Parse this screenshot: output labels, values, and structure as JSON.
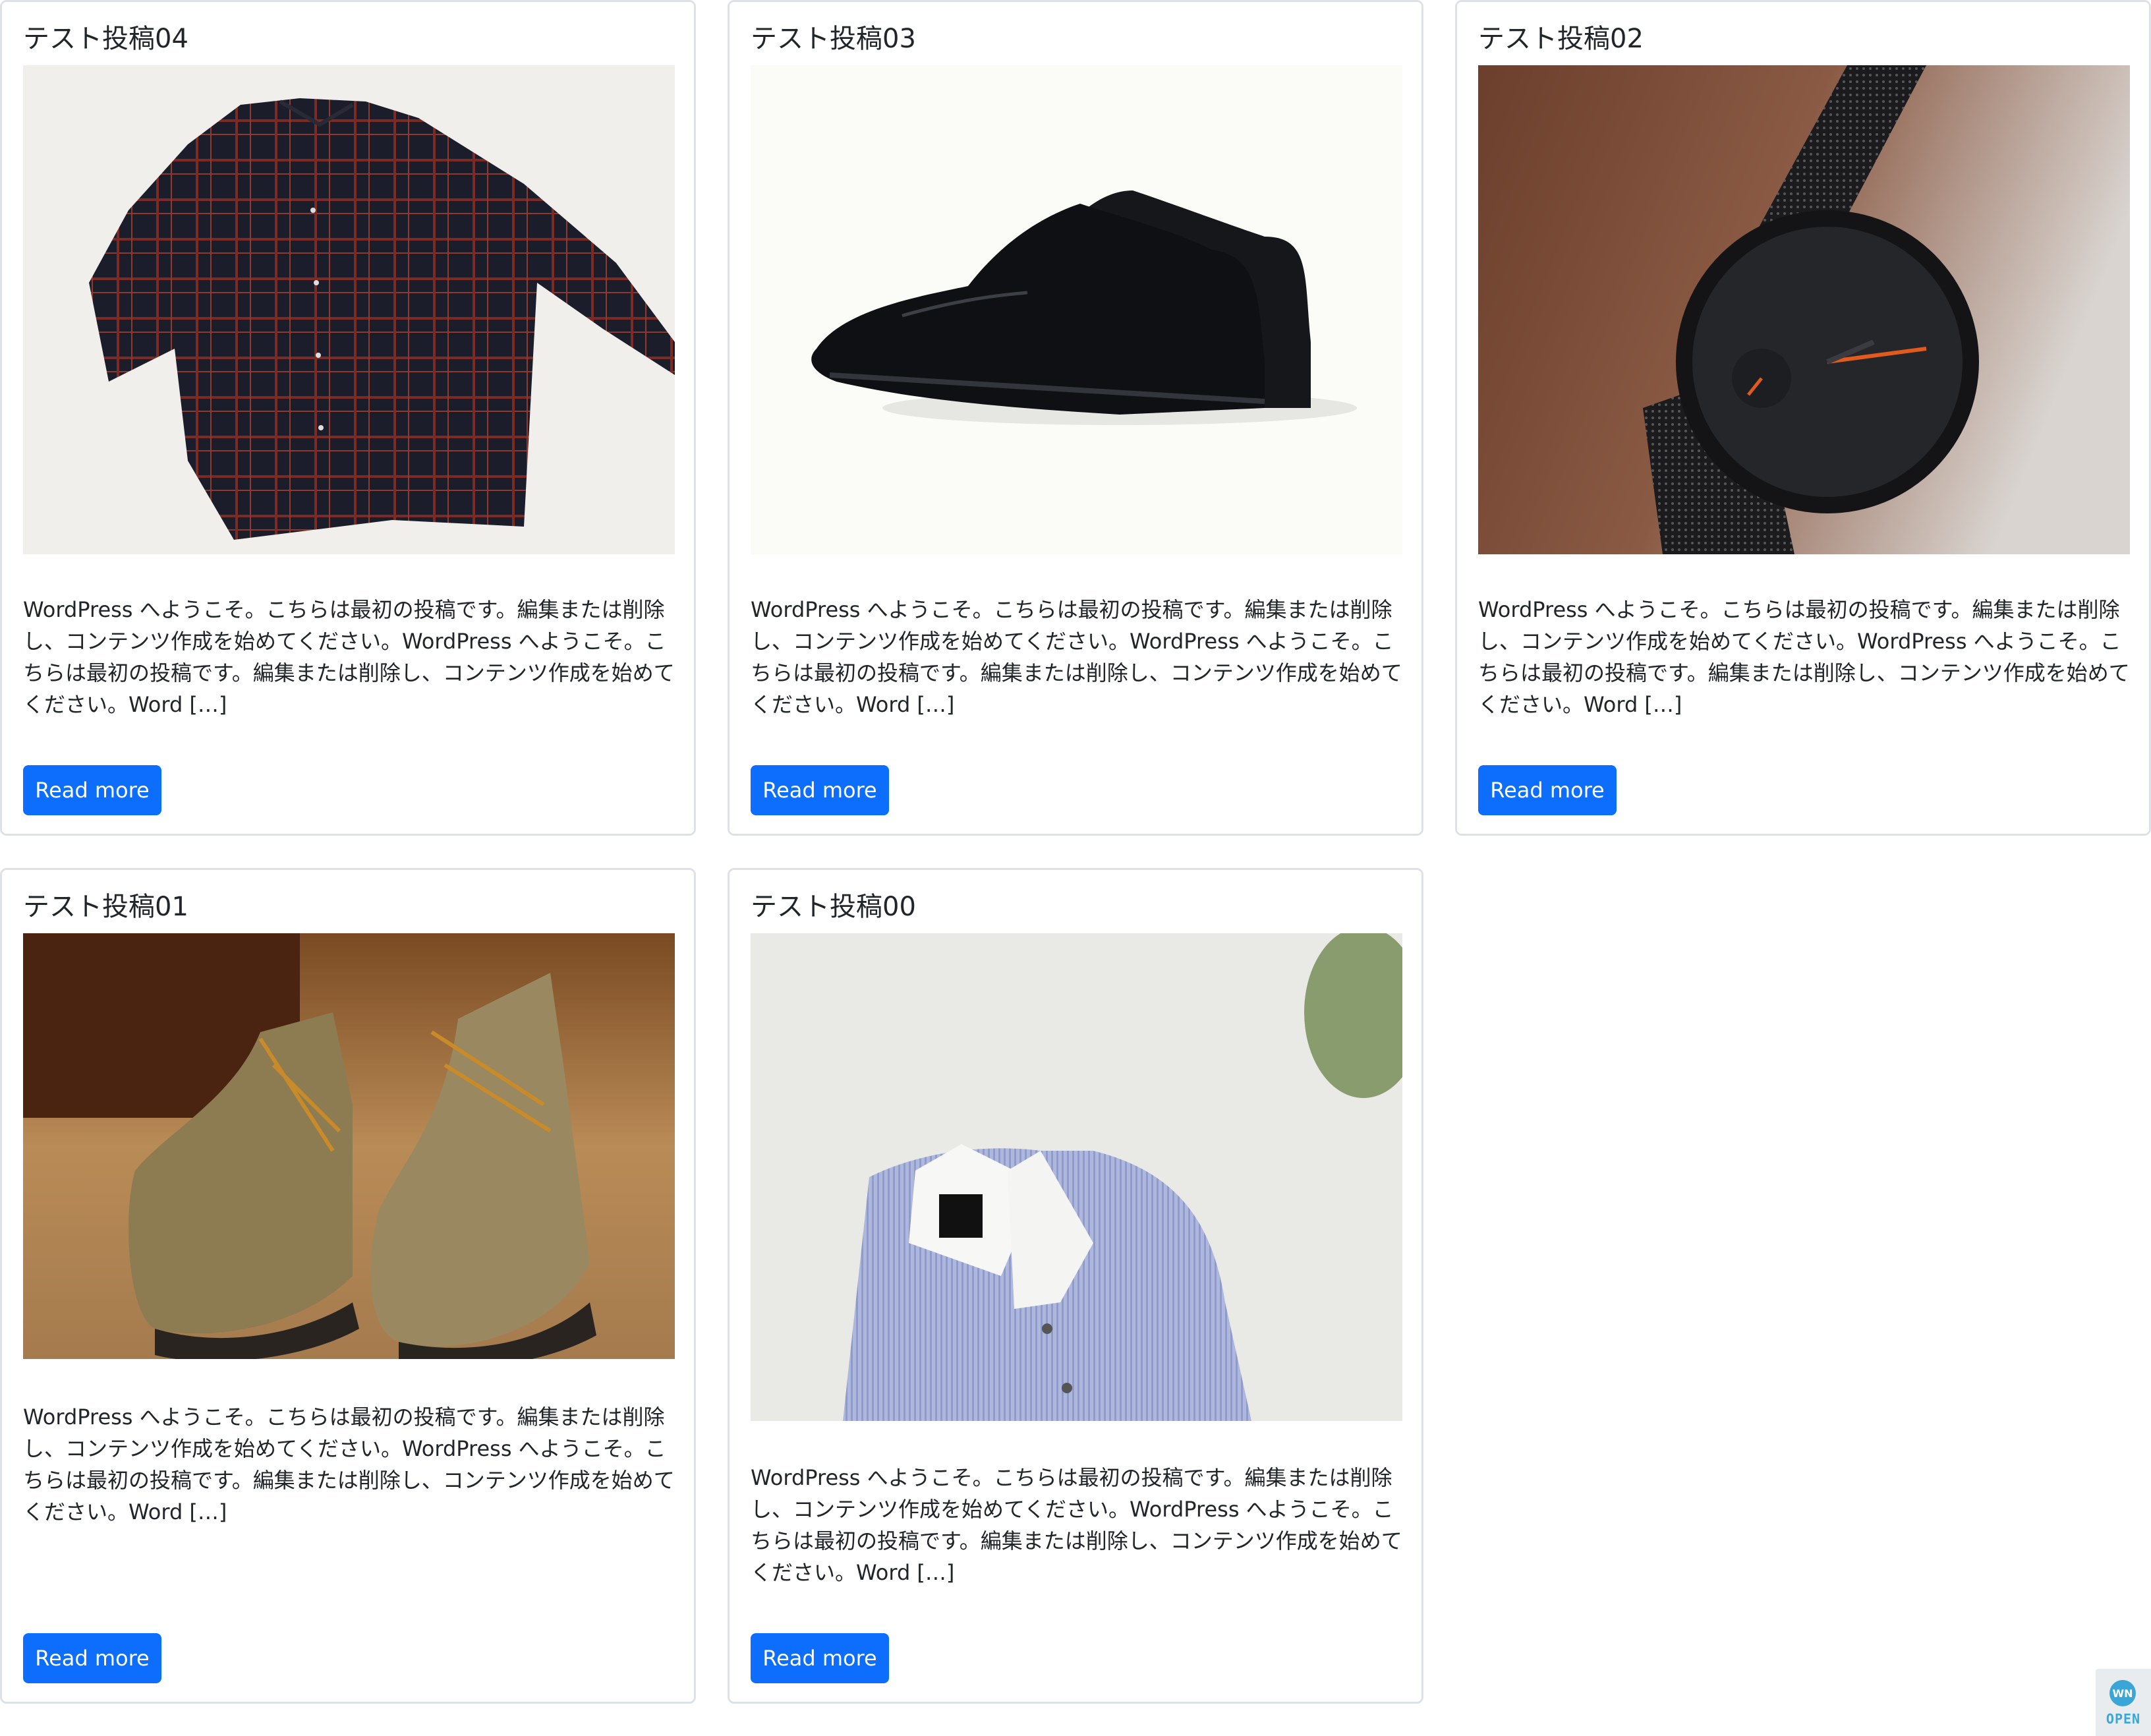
{
  "colors": {
    "button_bg": "#0d6efd",
    "button_text": "#ffffff",
    "card_border": "#dee2e6",
    "text": "#212529",
    "badge_accent": "#3aa6d8"
  },
  "posts": [
    {
      "title": "テスト投稿04",
      "image": "plaid-shirt-image",
      "excerpt": "WordPress へようこそ。こちらは最初の投稿です。編集または削除し、コンテンツ作成を始めてください。WordPress へようこそ。こちらは最初の投稿です。編集または削除し、コンテンツ作成を始めてください。Word […]",
      "button": "Read more"
    },
    {
      "title": "テスト投稿03",
      "image": "leather-shoes-image",
      "excerpt": "WordPress へようこそ。こちらは最初の投稿です。編集または削除し、コンテンツ作成を始めてください。WordPress へようこそ。こちらは最初の投稿です。編集または削除し、コンテンツ作成を始めてください。Word […]",
      "button": "Read more"
    },
    {
      "title": "テスト投稿02",
      "image": "wristwatch-image",
      "excerpt": "WordPress へようこそ。こちらは最初の投稿です。編集または削除し、コンテンツ作成を始めてください。WordPress へようこそ。こちらは最初の投稿です。編集または削除し、コンテンツ作成を始めてください。Word […]",
      "button": "Read more"
    },
    {
      "title": "テスト投稿01",
      "image": "hiking-boots-image",
      "excerpt": "WordPress へようこそ。こちらは最初の投稿です。編集または削除し、コンテンツ作成を始めてください。WordPress へようこそ。こちらは最初の投稿です。編集または削除し、コンテンツ作成を始めてください。Word […]",
      "button": "Read more"
    },
    {
      "title": "テスト投稿00",
      "image": "dress-shirt-image",
      "excerpt": "WordPress へようこそ。こちらは最初の投稿です。編集または削除し、コンテンツ作成を始めてください。WordPress へようこそ。こちらは最初の投稿です。編集または削除し、コンテンツ作成を始めてください。Word […]",
      "button": "Read more"
    }
  ],
  "badge": {
    "text": "OPEN",
    "icon": "wn-logo-icon"
  }
}
